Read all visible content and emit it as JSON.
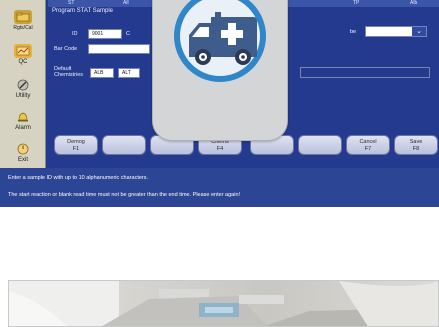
{
  "topbar": {
    "left_label": "ST",
    "all_label": "All",
    "tp_label": "TP",
    "alb_label": "Alb"
  },
  "window_title": "Program STAT Sample",
  "sidebar": {
    "items": [
      {
        "label": "Rgts/Cal",
        "icon": "folder-icon"
      },
      {
        "label": "QC",
        "icon": "chart-icon"
      },
      {
        "label": "Utility",
        "icon": "wrench-icon"
      },
      {
        "label": "Alarm",
        "icon": "bell-icon"
      },
      {
        "label": "Exit",
        "icon": "power-icon"
      }
    ]
  },
  "form": {
    "id_label": "ID",
    "id_value": "9001",
    "cup_label": "C",
    "bar_code_label": "Bar Code",
    "bar_code_value": "",
    "tube_label": "be",
    "default_chemistries_label_1": "Default",
    "default_chemistries_label_2": "Chemistries",
    "chemistries": [
      "ALB",
      "ALT"
    ]
  },
  "function_keys": [
    {
      "label": "Demog",
      "key": "F1"
    },
    {
      "label": "",
      "key": ""
    },
    {
      "label": "",
      "key": ""
    },
    {
      "label": "Chems",
      "key": "F4"
    },
    {
      "label": "",
      "key": ""
    },
    {
      "label": "",
      "key": ""
    },
    {
      "label": "Cancel",
      "key": "F7"
    },
    {
      "label": "Save",
      "key": "F8"
    }
  ],
  "status": {
    "line1": "Enter a sample ID with up to 10 alphanumeric characters.",
    "line2": "The start reaction or blank read time must not be greater than the end time. Please enter again!"
  },
  "overlay": {
    "icon": "ambulance-icon",
    "ring_color": "#2f86c9",
    "body_color": "#3f5d8c"
  }
}
